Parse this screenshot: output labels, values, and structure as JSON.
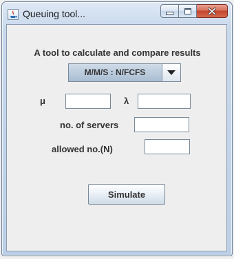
{
  "window": {
    "title": "Queuing tool...",
    "app_icon": "java-icon",
    "controls": {
      "minimize_icon": "minimize-icon",
      "maximize_icon": "maximize-icon",
      "close_icon": "close-icon"
    }
  },
  "form": {
    "heading": "A tool to calculate and compare results",
    "model_select": {
      "selected": "M/M/S : N/FCFS",
      "dropdown_icon": "chevron-down-icon"
    },
    "mu": {
      "label": "μ",
      "value": ""
    },
    "lambda": {
      "label": "λ",
      "value": ""
    },
    "servers": {
      "label": "no. of servers",
      "value": ""
    },
    "allowed": {
      "label": "allowed no.(N)",
      "value": ""
    },
    "simulate_label": "Simulate"
  },
  "colors": {
    "close_button": "#c4432d",
    "client_background": "#eeeeee",
    "combo_background": "#a9bdd2"
  }
}
